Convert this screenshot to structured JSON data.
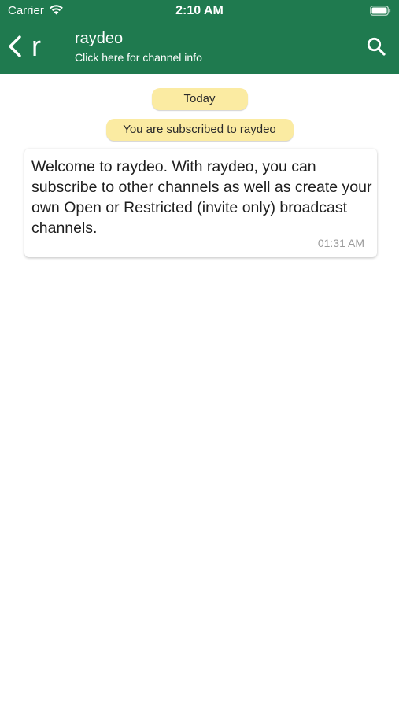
{
  "status_bar": {
    "carrier": "Carrier",
    "time": "2:10 AM"
  },
  "header": {
    "background_color": "#1f7a4f",
    "avatar_letter": "r",
    "channel_name": "raydeo",
    "channel_subtitle": "Click here for channel info",
    "icons": [
      "back-chevron-icon",
      "search-icon"
    ]
  },
  "chips": {
    "date": "Today",
    "subscription": "You are subscribed to raydeo",
    "chip_color": "#fbeba2"
  },
  "message": {
    "text": "Welcome to raydeo. With raydeo, you can subscribe to other channels as well as create your own Open or Restricted (invite only) broadcast channels.",
    "time": "01:31 AM"
  }
}
